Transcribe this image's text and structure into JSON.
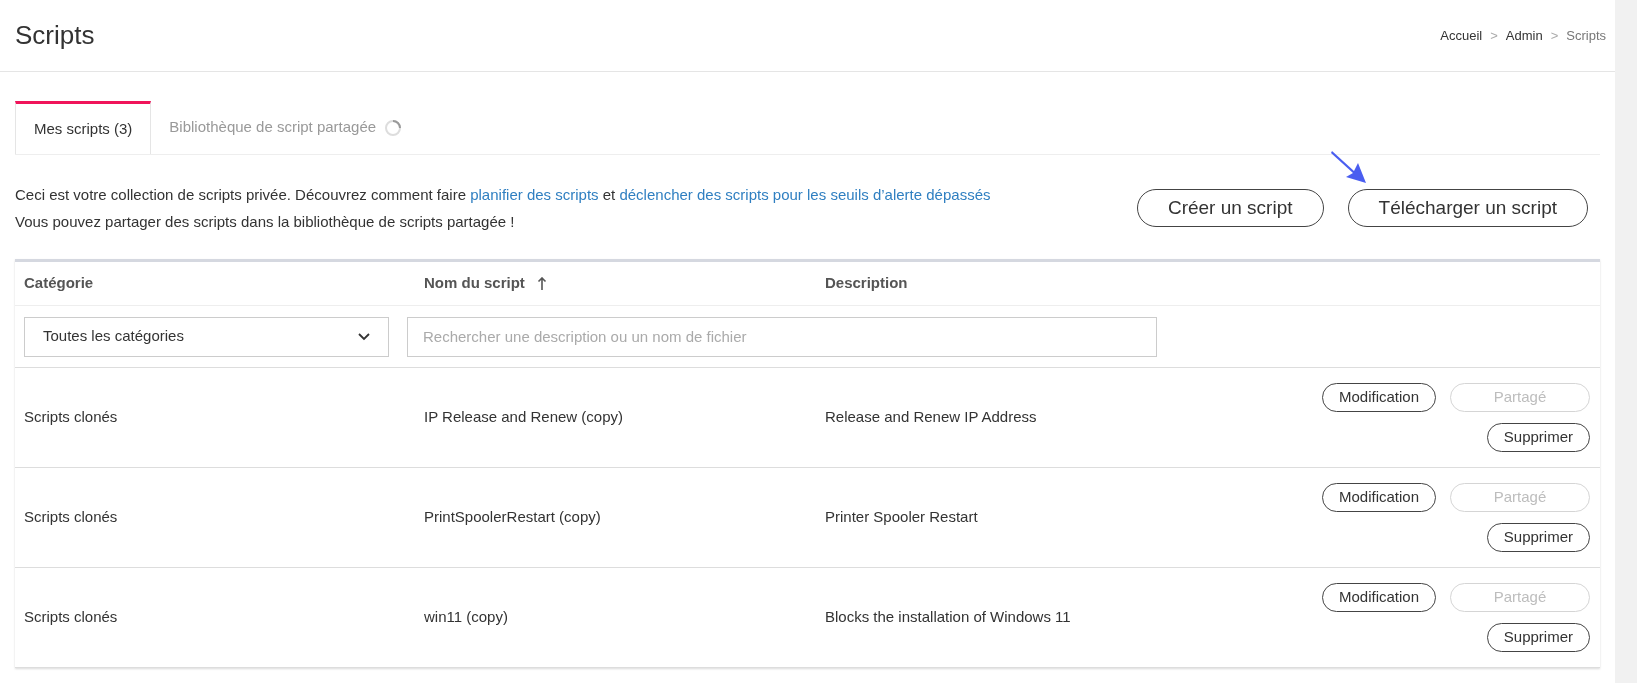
{
  "page": {
    "title": "Scripts"
  },
  "breadcrumb": [
    "Accueil",
    "Admin",
    "Scripts"
  ],
  "breadcrumb_separator": ">",
  "tabs": [
    {
      "label": "Mes scripts (3)",
      "selected": true,
      "loading": false
    },
    {
      "label": "Bibliothèque de script partagée",
      "selected": false,
      "loading": true
    }
  ],
  "intro": {
    "parts": [
      {
        "kind": "text",
        "text": "Ceci est votre collection de scripts privée. Découvrez comment faire "
      },
      {
        "kind": "link",
        "text": "planifier des scripts"
      },
      {
        "kind": "text",
        "text": " et "
      },
      {
        "kind": "link",
        "text": "déclencher des scripts pour les seuils d’alerte dépassés"
      }
    ],
    "line_2": "Vous pouvez partager des scripts dans la bibliothèque de scripts partagée !"
  },
  "actions": [
    "Créer un script",
    "Télécharger un script"
  ],
  "table": {
    "columns": [
      {
        "label": "Catégorie",
        "sorted": false
      },
      {
        "label": "Nom du script",
        "sorted": true
      },
      {
        "label": "Description",
        "sorted": false
      }
    ],
    "category_filter": {
      "value": "Toutes les catégories"
    },
    "search": {
      "placeholder": "Rechercher une description ou un nom de fichier"
    },
    "rows": [
      {
        "category": "Scripts clonés",
        "name": "IP Release and Renew (copy)",
        "description": "Release and Renew IP Address",
        "buttons": [
          {
            "label": "Modification",
            "disabled": false
          },
          {
            "label": "Partagé",
            "disabled": true
          },
          {
            "label": "Supprimer",
            "disabled": false
          }
        ]
      },
      {
        "category": "Scripts clonés",
        "name": "PrintSpoolerRestart (copy)",
        "description": "Printer Spooler Restart",
        "buttons": [
          {
            "label": "Modification",
            "disabled": false
          },
          {
            "label": "Partagé",
            "disabled": true
          },
          {
            "label": "Supprimer",
            "disabled": false
          }
        ]
      },
      {
        "category": "Scripts clonés",
        "name": "win11 (copy)",
        "description": "Blocks the installation of Windows 11",
        "buttons": [
          {
            "label": "Modification",
            "disabled": false
          },
          {
            "label": "Partagé",
            "disabled": true
          },
          {
            "label": "Supprimer",
            "disabled": false
          }
        ]
      }
    ]
  }
}
